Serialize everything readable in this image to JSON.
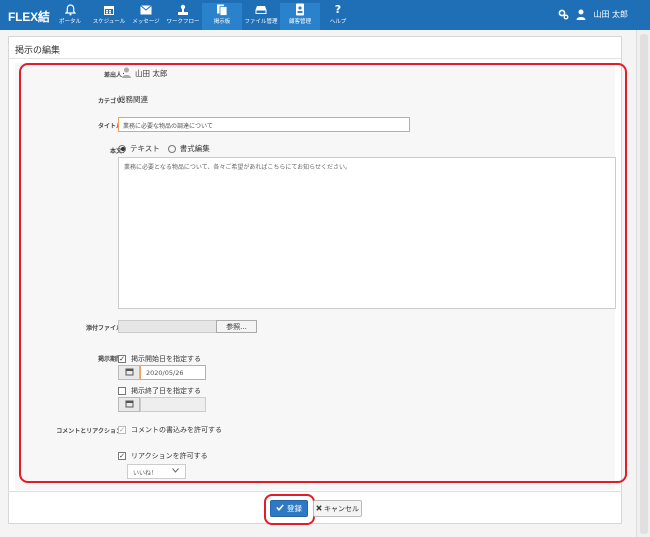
{
  "app": {
    "logo": "FLEX結"
  },
  "nav": [
    {
      "label": "ポータル",
      "icon": "bell-icon"
    },
    {
      "label": "スケジュール",
      "icon": "calendar-icon"
    },
    {
      "label": "メッセージ",
      "icon": "envelope-icon"
    },
    {
      "label": "ワークフロー",
      "icon": "workflow-icon"
    },
    {
      "label": "掲示板",
      "icon": "bulletin-icon"
    },
    {
      "label": "ファイル管理",
      "icon": "drive-icon"
    },
    {
      "label": "顧客管理",
      "icon": "customer-icon"
    },
    {
      "label": "ヘルプ",
      "icon": "help-icon"
    }
  ],
  "user": {
    "name": "山田 太郎"
  },
  "page": {
    "title": "掲示の編集"
  },
  "form": {
    "sender": {
      "label": "差出人：",
      "value": "山田 太郎"
    },
    "category": {
      "label": "カテゴリ：",
      "value": "総務関連"
    },
    "title": {
      "label": "タイトル：",
      "value": "業務に必要な物品の調達について"
    },
    "body": {
      "label": "本文：",
      "mode_text": "テキスト",
      "mode_rich": "書式編集",
      "selected_mode": "テキスト",
      "content": "業務に必要となる物品について、各々ご希望があればこちらにてお知らせください。"
    },
    "attachment": {
      "label": "添付ファイル：",
      "browse_label": "参照..."
    },
    "period": {
      "label": "掲示期間：",
      "start_label": "掲示開始日を指定する",
      "start_checked": true,
      "start_date": "2020/05/26",
      "end_label": "掲示終了日を指定する",
      "end_checked": false,
      "end_date": ""
    },
    "comments": {
      "label": "コメントとリアクション：",
      "allow_comments_label": "コメントの書込みを許可する",
      "allow_comments_checked": true,
      "allow_reactions_label": "リアクションを許可する",
      "allow_reactions_checked": true,
      "reaction_type": "いいね！"
    }
  },
  "actions": {
    "save_label": "登録",
    "cancel_label": "キャンセル"
  },
  "colors": {
    "header": "#1f6fb6",
    "accent": "#2e79c4",
    "highlight": "#e21c28",
    "focus_border": "#f0a060"
  }
}
